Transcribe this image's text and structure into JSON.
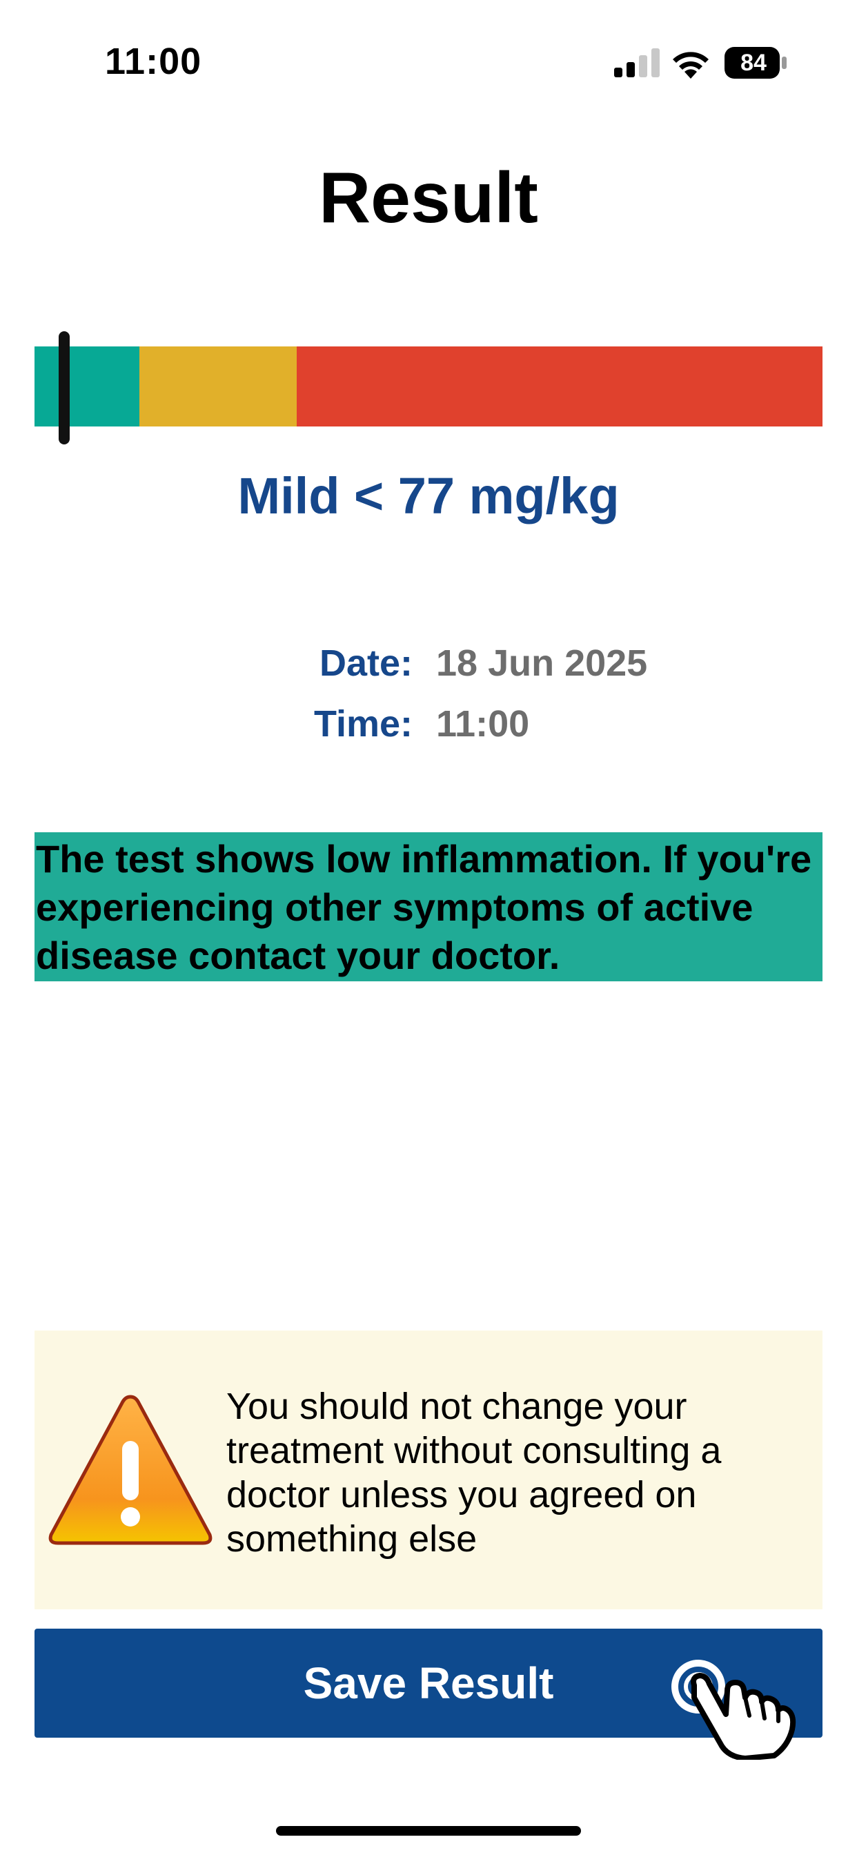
{
  "status_bar": {
    "time": "11:00",
    "battery": "84",
    "icons": [
      "signal-icon",
      "wifi-icon",
      "battery-icon"
    ]
  },
  "title": "Result",
  "severity": {
    "segments": [
      {
        "name": "mild",
        "color": "#07a995",
        "fraction": 0.133
      },
      {
        "name": "moderate",
        "color": "#e1b02a",
        "fraction": 0.2
      },
      {
        "name": "severe",
        "color": "#e0412d",
        "fraction": 0.667
      }
    ],
    "marker_fraction": 0.038,
    "level_label": "Mild < 77 mg/kg"
  },
  "details": {
    "date_label": "Date:",
    "date_value": "18 Jun 2025",
    "time_label": "Time:",
    "time_value": "11:00"
  },
  "message": {
    "text": "The test shows low inflammation. If you're experiencing other symptoms of active disease contact your doctor.",
    "background": "#20ab96"
  },
  "warning": {
    "icon": "warning-triangle-icon",
    "text": "You should not change your treatment without consulting a doctor unless you agreed on something else",
    "background": "#fcf8e3"
  },
  "save_button": {
    "label": "Save Result",
    "color": "#0e4a8e"
  },
  "colors": {
    "accent_blue": "#16478b"
  }
}
